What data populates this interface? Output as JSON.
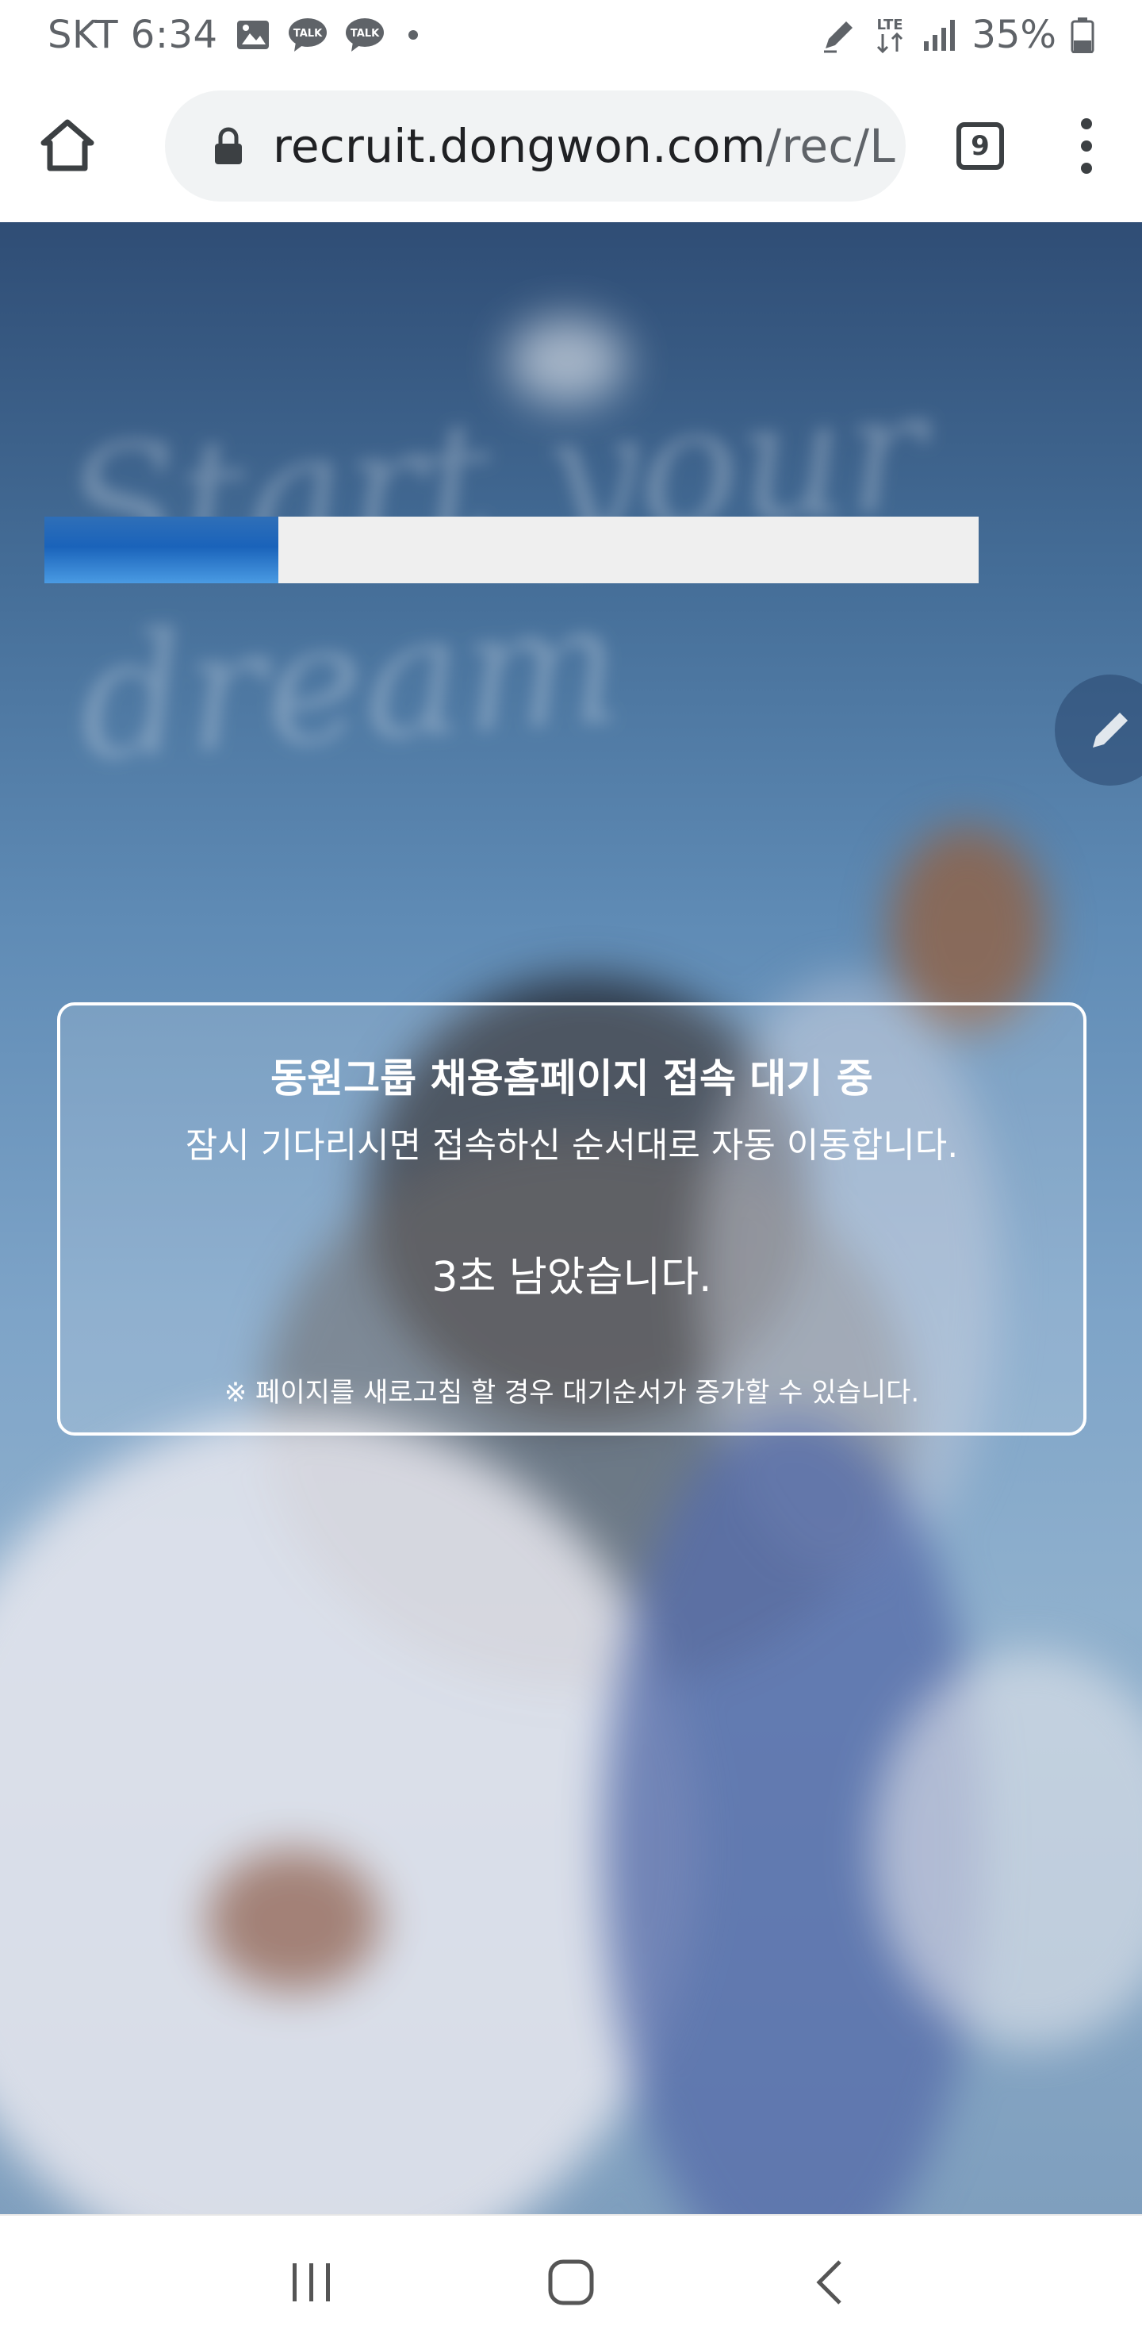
{
  "status_bar": {
    "carrier_time": "SKT 6:34",
    "battery": "35%",
    "icons": [
      "gallery-icon",
      "kakaotalk-icon",
      "kakaotalk-icon",
      "dot-icon",
      "stylus-icon",
      "lte-icon",
      "signal-icon",
      "battery-icon"
    ],
    "talk_badge": "TALK",
    "lte_label": "LTE"
  },
  "browser": {
    "url_domain": "recruit.dongwon.com",
    "url_path": "/rec/L",
    "tab_count": "9",
    "icons": [
      "home-icon",
      "lock-icon",
      "more-vert-icon"
    ]
  },
  "wait_dialog": {
    "title": "동원그룹 채용홈페이지 접속 대기 중",
    "subtitle": "잠시 기다리시면 접속하신 순서대로 자동 이동합니다.",
    "remaining": "3초 남았습니다.",
    "progress_fraction": 0.25,
    "note": "※ 페이지를 새로고침 할 경우 대기순서가 증가할 수 있습니다."
  },
  "background": {
    "blurred_text": "Start your dream"
  },
  "colors": {
    "progress_fill": "#1a63ba",
    "progress_track": "#efefef",
    "dialog_border": "#ffffff",
    "sky_top": "#2f4d75",
    "sky_bottom": "#8fb0cd"
  },
  "nav_bar": {
    "icons": [
      "recent-apps-icon",
      "home-nav-icon",
      "back-icon"
    ]
  }
}
